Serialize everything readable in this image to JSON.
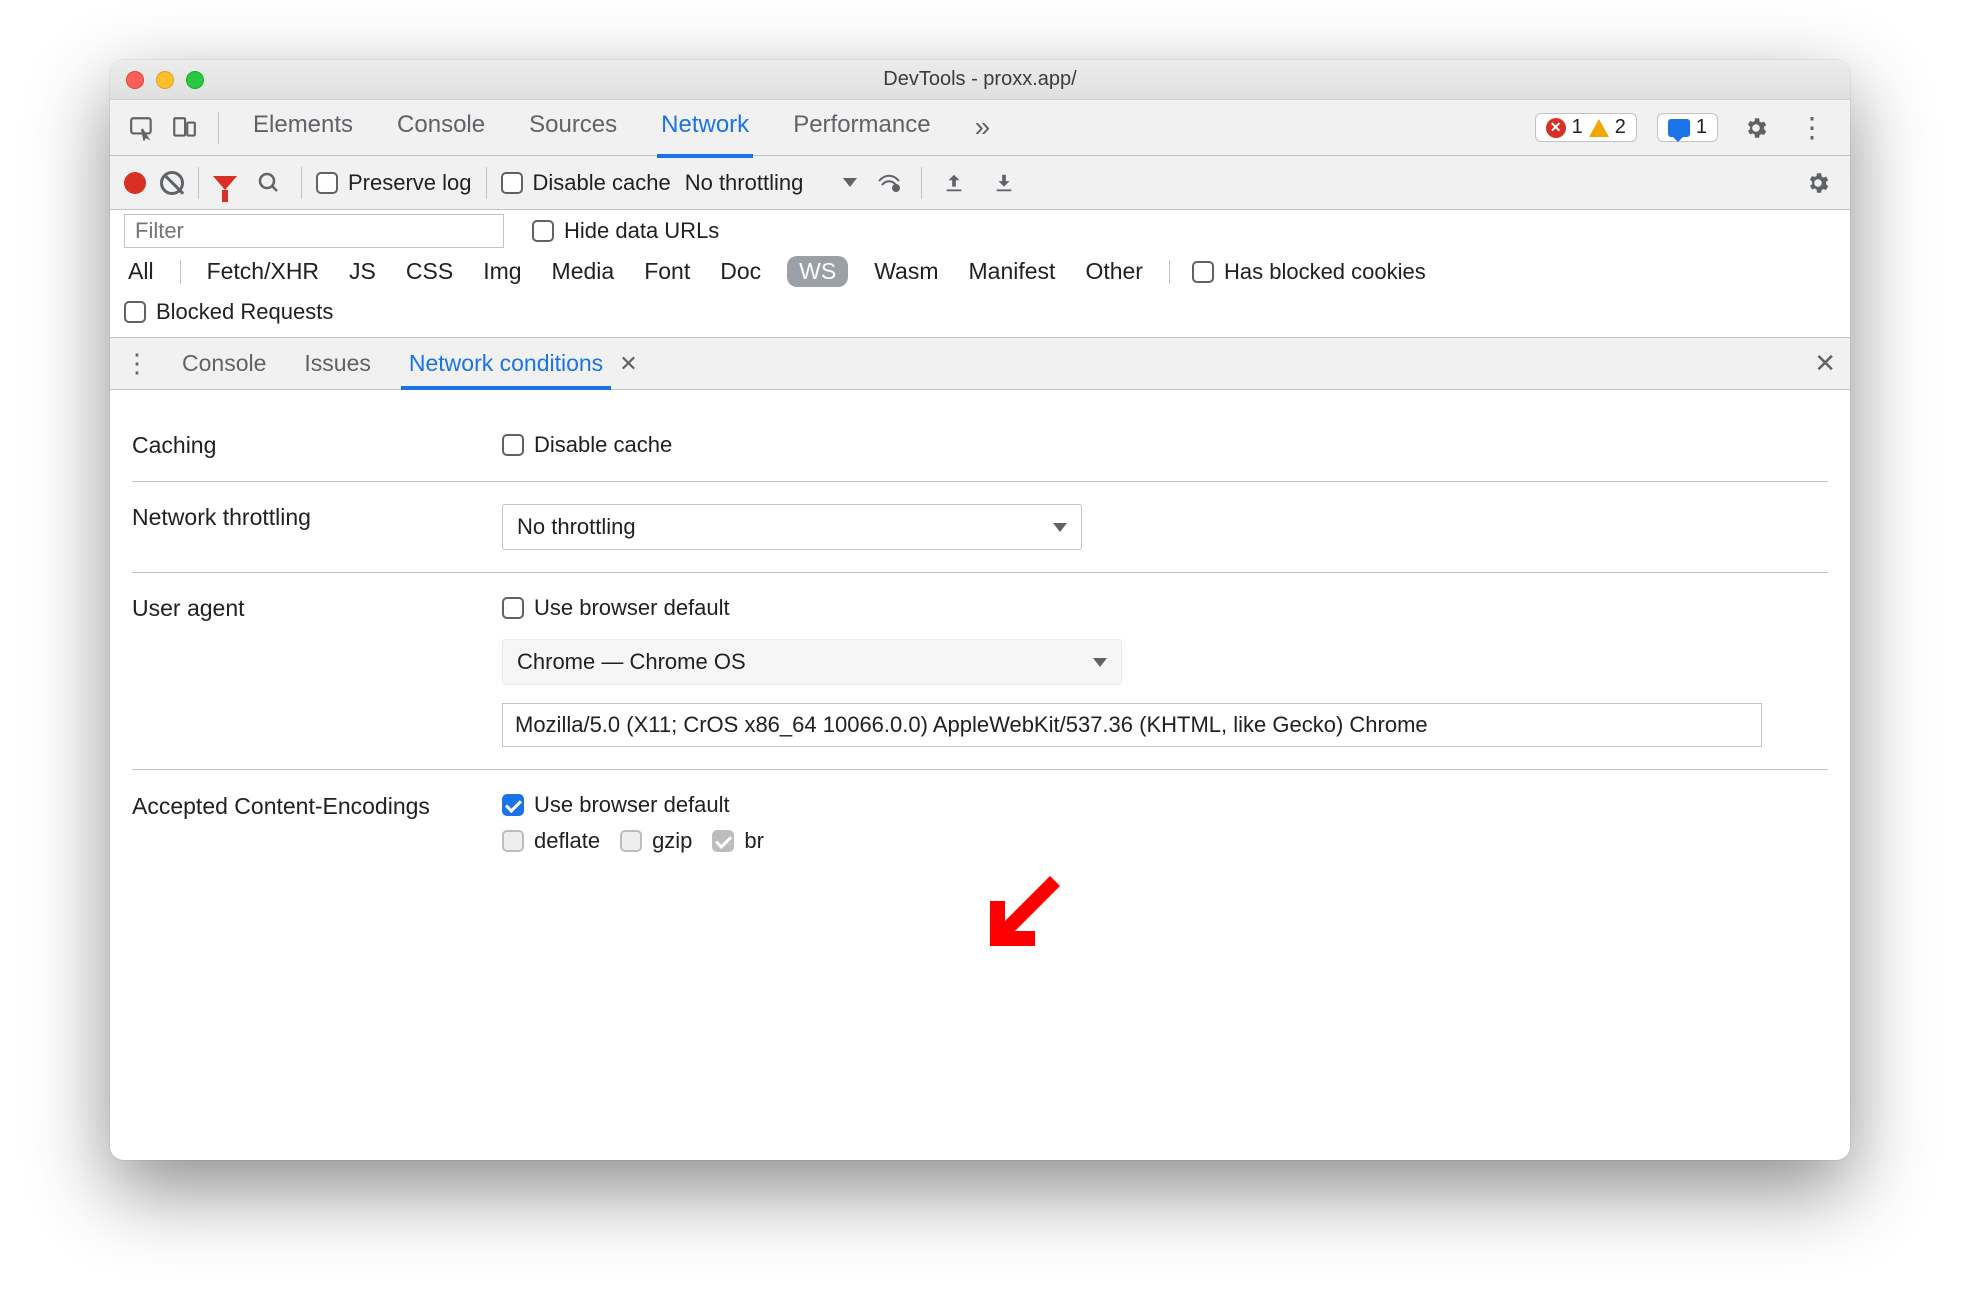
{
  "window": {
    "title": "DevTools - proxx.app/"
  },
  "main_tabs": {
    "items": [
      "Elements",
      "Console",
      "Sources",
      "Network",
      "Performance"
    ],
    "active": "Network",
    "more": "»"
  },
  "status": {
    "errors": "1",
    "warnings": "2",
    "messages": "1"
  },
  "net_toolbar": {
    "preserve_log": "Preserve log",
    "disable_cache": "Disable cache",
    "throttling": "No throttling"
  },
  "filters": {
    "placeholder": "Filter",
    "hide_data_urls": "Hide data URLs",
    "types": [
      "All",
      "Fetch/XHR",
      "JS",
      "CSS",
      "Img",
      "Media",
      "Font",
      "Doc",
      "WS",
      "Wasm",
      "Manifest",
      "Other"
    ],
    "active_type": "WS",
    "has_blocked_cookies": "Has blocked cookies",
    "blocked_requests": "Blocked Requests"
  },
  "drawer": {
    "tabs": [
      "Console",
      "Issues",
      "Network conditions"
    ],
    "active": "Network conditions"
  },
  "conditions": {
    "caching_label": "Caching",
    "caching_disable": "Disable cache",
    "throttling_label": "Network throttling",
    "throttling_value": "No throttling",
    "ua_label": "User agent",
    "ua_use_default": "Use browser default",
    "ua_select": "Chrome — Chrome OS",
    "ua_string": "Mozilla/5.0 (X11; CrOS x86_64 10066.0.0) AppleWebKit/537.36 (KHTML, like Gecko) Chrome",
    "enc_label": "Accepted Content-Encodings",
    "enc_use_default": "Use browser default",
    "enc_deflate": "deflate",
    "enc_gzip": "gzip",
    "enc_br": "br"
  }
}
